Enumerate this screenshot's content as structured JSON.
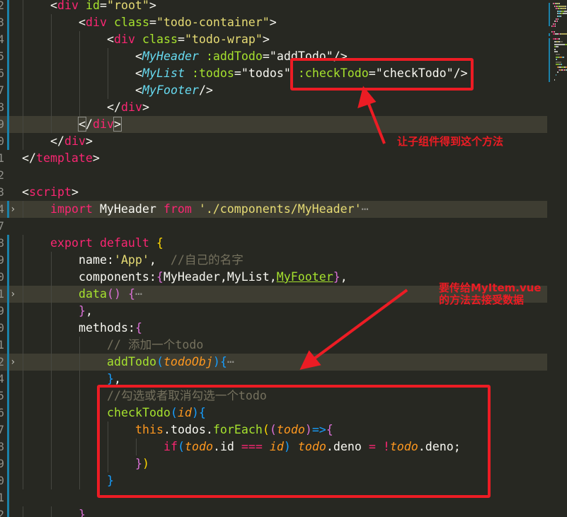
{
  "editor": {
    "colors": {
      "background": "#272822",
      "line_highlight": "#3e3d32",
      "git_bar": "#1b81a8",
      "annotation": "#ec1c24"
    },
    "lines": [
      {
        "n": "2",
        "indent": 1,
        "git": true,
        "tokens": [
          [
            "punc",
            "<"
          ],
          [
            "tag",
            "div"
          ],
          [
            "punc",
            " "
          ],
          [
            "attr",
            "id"
          ],
          [
            "punc",
            "="
          ],
          [
            "str",
            "\"root\""
          ],
          [
            "punc",
            ">"
          ]
        ]
      },
      {
        "n": "3",
        "indent": 2,
        "git": true,
        "tokens": [
          [
            "punc",
            "<"
          ],
          [
            "tag",
            "div"
          ],
          [
            "punc",
            " "
          ],
          [
            "attr",
            "class"
          ],
          [
            "punc",
            "="
          ],
          [
            "str",
            "\"todo-container\""
          ],
          [
            "punc",
            ">"
          ]
        ]
      },
      {
        "n": "4",
        "indent": 3,
        "git": true,
        "tokens": [
          [
            "punc",
            "<"
          ],
          [
            "tag",
            "div"
          ],
          [
            "punc",
            " "
          ],
          [
            "attr",
            "class"
          ],
          [
            "punc",
            "="
          ],
          [
            "str",
            "\"todo-wrap\""
          ],
          [
            "punc",
            ">"
          ]
        ]
      },
      {
        "n": "5",
        "indent": 4,
        "git": true,
        "tokens": [
          [
            "punc",
            "<"
          ],
          [
            "comp",
            "MyHeader"
          ],
          [
            "punc",
            " "
          ],
          [
            "attr",
            ":addTodo"
          ],
          [
            "punc",
            "="
          ],
          [
            "punc",
            "\"addTodo\""
          ],
          [
            "punc",
            "/>"
          ]
        ]
      },
      {
        "n": "6",
        "indent": 4,
        "git": true,
        "tokens": [
          [
            "punc",
            "<"
          ],
          [
            "comp",
            "MyList"
          ],
          [
            "punc",
            " "
          ],
          [
            "attr",
            ":todos"
          ],
          [
            "punc",
            "="
          ],
          [
            "punc",
            "\"todos\""
          ],
          [
            "punc",
            " "
          ],
          [
            "attr",
            ":checkTodo"
          ],
          [
            "punc",
            "="
          ],
          [
            "punc",
            "\"checkTodo\""
          ],
          [
            "punc",
            "/>"
          ]
        ]
      },
      {
        "n": "7",
        "indent": 4,
        "git": true,
        "tokens": [
          [
            "punc",
            "<"
          ],
          [
            "comp",
            "MyFooter"
          ],
          [
            "punc",
            "/>"
          ]
        ]
      },
      {
        "n": "8",
        "indent": 3,
        "git": true,
        "tokens": [
          [
            "punc",
            "</"
          ],
          [
            "tag",
            "div"
          ],
          [
            "punc",
            ">"
          ]
        ]
      },
      {
        "n": "9",
        "indent": 2,
        "git": true,
        "hl": true,
        "tokens": [
          [
            "bmpunc",
            "<"
          ],
          [
            "punc",
            "/"
          ],
          [
            "tag",
            "div"
          ],
          [
            "bmpunc",
            ">"
          ]
        ]
      },
      {
        "n": "0",
        "indent": 1,
        "git": true,
        "tokens": [
          [
            "punc",
            "</"
          ],
          [
            "tag",
            "div"
          ],
          [
            "punc",
            ">"
          ]
        ]
      },
      {
        "n": "1",
        "indent": 0,
        "tokens": [
          [
            "punc",
            "</"
          ],
          [
            "tag",
            "template"
          ],
          [
            "punc",
            ">"
          ]
        ]
      },
      {
        "n": "2",
        "indent": 0,
        "tokens": []
      },
      {
        "n": "3",
        "indent": 0,
        "tokens": [
          [
            "punc",
            "<"
          ],
          [
            "tag",
            "script"
          ],
          [
            "punc",
            ">"
          ]
        ]
      },
      {
        "n": "4",
        "indent": 1,
        "git": true,
        "fold": true,
        "hl": true,
        "tokens": [
          [
            "kw",
            "import"
          ],
          [
            "punc",
            " MyHeader "
          ],
          [
            "kw",
            "from"
          ],
          [
            "punc",
            " "
          ],
          [
            "str",
            "'./components/MyHeader'"
          ],
          [
            "ell",
            "⋯"
          ]
        ]
      },
      {
        "n": "7",
        "indent": 0,
        "tokens": []
      },
      {
        "n": "8",
        "indent": 1,
        "git": true,
        "tokens": [
          [
            "kw",
            "export"
          ],
          [
            "punc",
            " "
          ],
          [
            "kw",
            "default"
          ],
          [
            "punc",
            " "
          ],
          [
            "y",
            "{"
          ]
        ]
      },
      {
        "n": "9",
        "indent": 2,
        "git": true,
        "tokens": [
          [
            "punc",
            "name:"
          ],
          [
            "str",
            "'App'"
          ],
          [
            "punc",
            ",  "
          ],
          [
            "cmt",
            "//自己的名字"
          ]
        ]
      },
      {
        "n": "0",
        "indent": 2,
        "git": true,
        "tokens": [
          [
            "punc",
            "components:"
          ],
          [
            "p",
            "{"
          ],
          [
            "punc",
            "MyHeader,MyList,"
          ],
          [
            "ul",
            "MyFooter"
          ],
          [
            "p",
            "}"
          ],
          [
            "punc",
            ","
          ]
        ]
      },
      {
        "n": "1",
        "indent": 2,
        "git": true,
        "fold": true,
        "hl": true,
        "tokens": [
          [
            "fn",
            "data"
          ],
          [
            "p",
            "()"
          ],
          [
            "punc",
            " "
          ],
          [
            "p",
            "{"
          ],
          [
            "ell",
            "⋯"
          ]
        ]
      },
      {
        "n": "9",
        "indent": 2,
        "git": true,
        "tokens": [
          [
            "p",
            "}"
          ],
          [
            "punc",
            ","
          ]
        ]
      },
      {
        "n": "0",
        "indent": 2,
        "git": true,
        "tokens": [
          [
            "punc",
            "methods:"
          ],
          [
            "p",
            "{"
          ]
        ]
      },
      {
        "n": "1",
        "indent": 3,
        "git": true,
        "tokens": [
          [
            "cmt",
            "// 添加一个todo"
          ]
        ]
      },
      {
        "n": "2",
        "indent": 3,
        "git": true,
        "fold": true,
        "hl": true,
        "tokens": [
          [
            "fn",
            "addTodo"
          ],
          [
            "b",
            "("
          ],
          [
            "par",
            "todoObj"
          ],
          [
            "b",
            ")"
          ],
          [
            "b",
            "{"
          ],
          [
            "ell",
            "⋯"
          ]
        ]
      },
      {
        "n": "4",
        "indent": 3,
        "git": true,
        "tokens": [
          [
            "b",
            "}"
          ],
          [
            "punc",
            ","
          ]
        ]
      },
      {
        "n": "5",
        "indent": 3,
        "git": true,
        "tokens": [
          [
            "cmt",
            "//勾选或者取消勾选一个todo"
          ]
        ]
      },
      {
        "n": "6",
        "indent": 3,
        "git": true,
        "tokens": [
          [
            "fn",
            "checkTodo"
          ],
          [
            "b",
            "("
          ],
          [
            "par",
            "id"
          ],
          [
            "b",
            ")"
          ],
          [
            "b",
            "{"
          ]
        ]
      },
      {
        "n": "7",
        "indent": 4,
        "git": true,
        "tokens": [
          [
            "this",
            "this"
          ],
          [
            "punc",
            ".todos."
          ],
          [
            "fn",
            "forEach"
          ],
          [
            "y",
            "("
          ],
          [
            "p",
            "("
          ],
          [
            "par",
            "todo"
          ],
          [
            "p",
            ")"
          ],
          [
            "b",
            "=>"
          ],
          [
            "p",
            "{"
          ]
        ]
      },
      {
        "n": "8",
        "indent": 5,
        "git": true,
        "tokens": [
          [
            "kw",
            "if"
          ],
          [
            "b",
            "("
          ],
          [
            "par",
            "todo"
          ],
          [
            "punc",
            ".id "
          ],
          [
            "op",
            "==="
          ],
          [
            "punc",
            " "
          ],
          [
            "par",
            "id"
          ],
          [
            "b",
            ")"
          ],
          [
            "punc",
            " "
          ],
          [
            "par",
            "todo"
          ],
          [
            "punc",
            ".deno "
          ],
          [
            "op",
            "="
          ],
          [
            "punc",
            " "
          ],
          [
            "op",
            "!"
          ],
          [
            "par",
            "todo"
          ],
          [
            "punc",
            ".deno;"
          ]
        ]
      },
      {
        "n": "9",
        "indent": 4,
        "git": true,
        "tokens": [
          [
            "p",
            "}"
          ],
          [
            "y",
            ")"
          ]
        ]
      },
      {
        "n": "0",
        "indent": 3,
        "git": true,
        "tokens": [
          [
            "b",
            "}"
          ]
        ]
      },
      {
        "n": "1",
        "indent": 0,
        "git": true,
        "tokens": []
      },
      {
        "n": "2",
        "indent": 2,
        "git": true,
        "tokens": [
          [
            "p",
            "}"
          ]
        ]
      }
    ]
  },
  "annotations": {
    "note1": "让子组件得到这个方法",
    "note2_line1": "要传给MyItem.vue",
    "note2_line2": "的方法去接受数据"
  }
}
